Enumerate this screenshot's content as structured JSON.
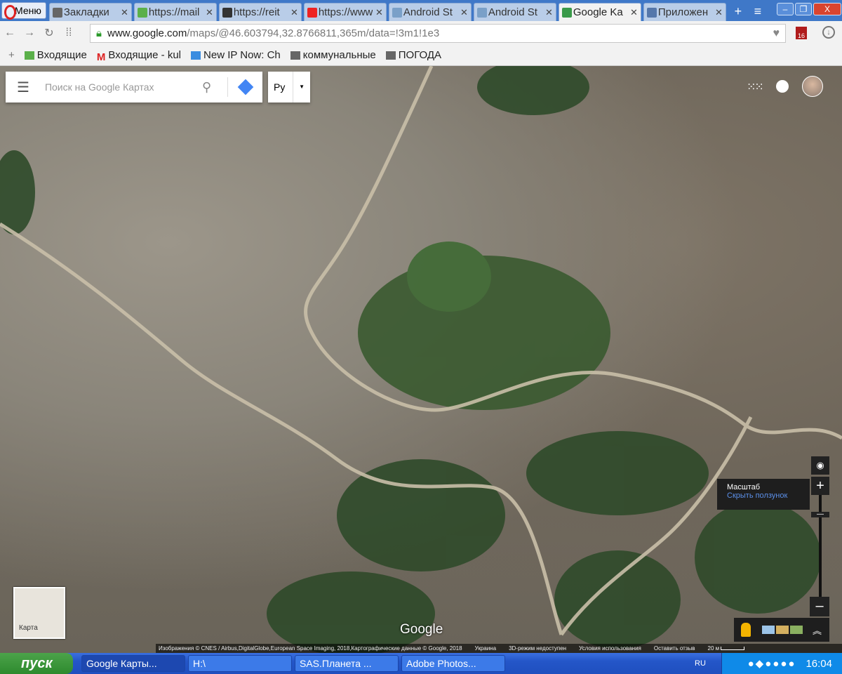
{
  "browser": {
    "menu_label": "Меню",
    "tabs": [
      {
        "title": "Закладки",
        "color": "#666"
      },
      {
        "title": "https://mail",
        "color": "#5bb04a"
      },
      {
        "title": "https://reit",
        "color": "#333"
      },
      {
        "title": "https://www",
        "color": "#e22"
      },
      {
        "title": "Android St",
        "color": "#7aa0c8"
      },
      {
        "title": "Android St",
        "color": "#7aa0c8"
      },
      {
        "title": "Google Ka",
        "color": "#3a9a4a"
      },
      {
        "title": "Приложен",
        "color": "#5577aa"
      }
    ],
    "active_tab": 6,
    "url_host": "www.google.com",
    "url_path": "/maps/@46.603794,32.8766811,365m/data=!3m1!1e3",
    "bookmarks": [
      "Входящие",
      "Входящие - kul",
      "New IP Now: Ch",
      "коммунальные",
      "ПОГОДА"
    ],
    "ext_badge": "16"
  },
  "maps": {
    "search_placeholder": "Поиск на Google Картах",
    "lang": "Ру",
    "layer_label": "Карта",
    "logo": "Google",
    "tooltip_title": "Масштаб",
    "tooltip_link": "Скрыть ползунок",
    "footer": [
      "Изображения © CNES / Airbus,DigitalGlobe,European Space Imaging, 2018,Картографические данные © Google, 2018",
      "Украина",
      "3D-режим недоступен",
      "Условия использования",
      "Оставить отзыв"
    ],
    "scale": "20 м"
  },
  "taskbar": {
    "start": "пуск",
    "tasks": [
      "Google Карты...",
      "H:\\",
      "SAS.Планета ...",
      "Adobe Photos..."
    ],
    "lang": "RU",
    "clock": "16:04"
  }
}
